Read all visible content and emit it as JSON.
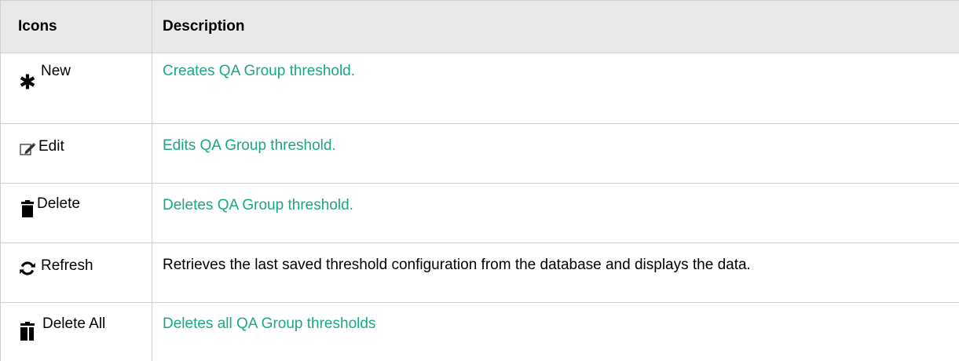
{
  "table": {
    "headers": {
      "icons": "Icons",
      "description": "Description"
    },
    "rows": [
      {
        "icon": "asterisk-icon",
        "label": "New",
        "description": "Creates QA Group threshold.",
        "is_link": true
      },
      {
        "icon": "edit-icon",
        "label": "Edit",
        "description": "Edits QA Group threshold.",
        "is_link": true
      },
      {
        "icon": "trash-icon",
        "label": "Delete",
        "description": "Deletes QA Group threshold.",
        "is_link": true
      },
      {
        "icon": "refresh-icon",
        "label": "Refresh",
        "description": "Retrieves the last saved threshold configuration from the database and displays the data.",
        "is_link": false
      },
      {
        "icon": "delete-all-icon",
        "label": "Delete All",
        "description": "Deletes all QA Group thresholds",
        "is_link": true
      }
    ]
  },
  "colors": {
    "link": "#1ba686",
    "header_bg": "#e9e9e9",
    "border": "#cfcfcf"
  }
}
